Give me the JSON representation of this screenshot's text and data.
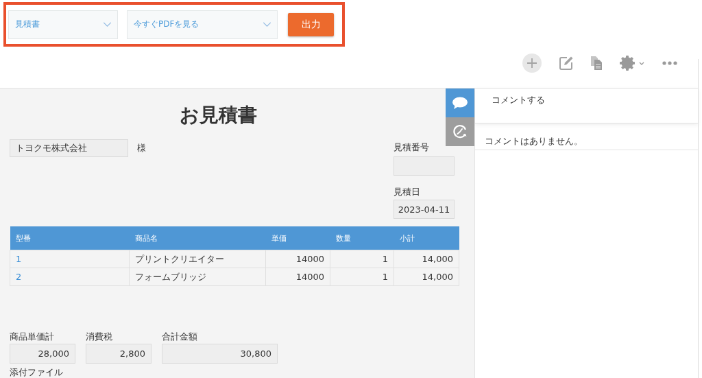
{
  "toolbar": {
    "template_select": {
      "value": "見積書"
    },
    "action_select": {
      "value": "今すぐPDFを見る"
    },
    "output_button": {
      "label": "出力"
    }
  },
  "form": {
    "title": "お見積書",
    "customer": {
      "value": "トヨクモ株式会社",
      "suffix": "様"
    },
    "quote_number": {
      "label": "見積番号"
    },
    "quote_date": {
      "label": "見積日",
      "value": "2023-04-11"
    },
    "table": {
      "columns": [
        "型番",
        "商品名",
        "単価",
        "数量",
        "小計"
      ],
      "rows": [
        [
          "1",
          "プリントクリエイター",
          "14000",
          "1",
          "14,000"
        ],
        [
          "2",
          "フォームブリッジ",
          "14000",
          "1",
          "14,000"
        ]
      ]
    },
    "totals": [
      {
        "label": "商品単価計",
        "value": "28,000"
      },
      {
        "label": "消費税",
        "value": "2,800"
      },
      {
        "label": "合計金額",
        "value": "30,800"
      }
    ],
    "attachments": {
      "label": "添付ファイル"
    }
  },
  "side_tabs": [
    {
      "kind": "comments",
      "selected": true
    },
    {
      "kind": "history",
      "selected": false
    }
  ],
  "comments": {
    "placeholder": "コメントする",
    "empty_message": "コメントはありません。"
  }
}
